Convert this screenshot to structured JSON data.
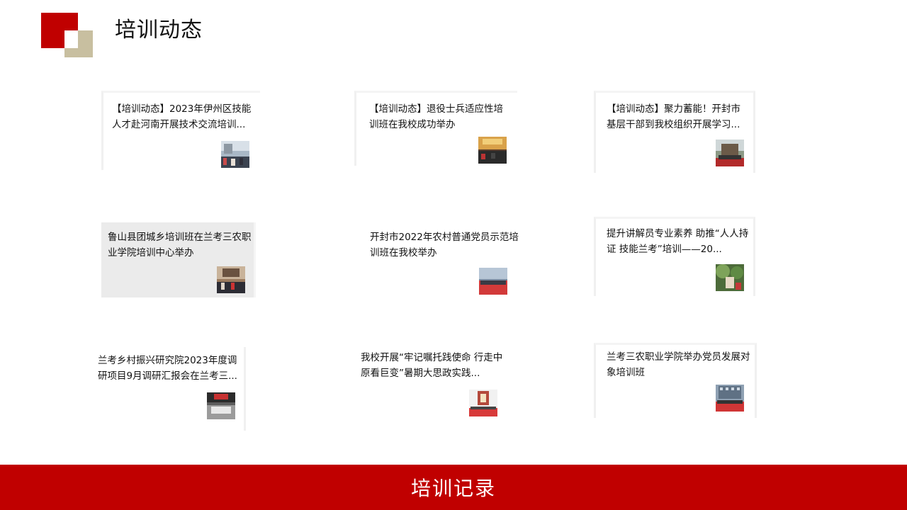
{
  "header": {
    "title": "培训动态"
  },
  "cards": [
    {
      "title": "【培训动态】2023年伊州区技能人才赴河南开展技术交流培训..."
    },
    {
      "title": "【培训动态】退役士兵适应性培训班在我校成功举办"
    },
    {
      "title": "【培训动态】聚力蓄能！开封市基层干部到我校组织开展学习..."
    },
    {
      "title": "鲁山县团城乡培训班在兰考三农职业学院培训中心举办"
    },
    {
      "title": "开封市2022年农村普通党员示范培训班在我校举办"
    },
    {
      "title": "提升讲解员专业素养  助推“人人持证 技能兰考”培训——20..."
    },
    {
      "title": "兰考乡村振兴研究院2023年度调研项目9月调研汇报会在兰考三..."
    },
    {
      "title": "我校开展“牢记嘱托践使命 行走中原看巨变”暑期大思政实践..."
    },
    {
      "title": "兰考三农职业学院举办党员发展对象培训班"
    }
  ],
  "footer": {
    "button_label": "培训记录"
  }
}
